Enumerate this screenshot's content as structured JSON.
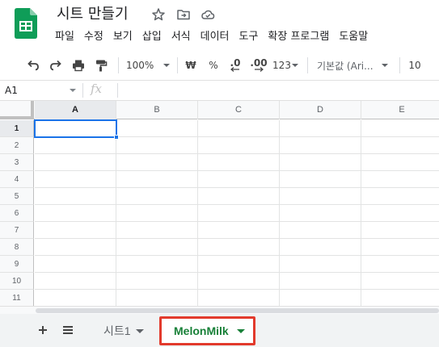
{
  "app": {
    "doc_title": "시트 만들기"
  },
  "menu": [
    "파일",
    "수정",
    "보기",
    "삽입",
    "서식",
    "데이터",
    "도구",
    "확장 프로그램",
    "도움말"
  ],
  "toolbar": {
    "zoom": "100%",
    "currency": "₩",
    "percent": "%",
    "dec_decrease": ".0",
    "dec_increase": ".00",
    "more_formats": "123",
    "font": "기본값 (Ari...",
    "font_size": "10"
  },
  "formula_bar": {
    "name_box": "A1",
    "fx": "fx",
    "value": ""
  },
  "grid": {
    "columns": [
      "A",
      "B",
      "C",
      "D",
      "E"
    ],
    "rows": [
      "1",
      "2",
      "3",
      "4",
      "5",
      "6",
      "7",
      "8",
      "9",
      "10",
      "11"
    ],
    "selected_cell": "A1"
  },
  "sheets": {
    "tabs": [
      {
        "label": "시트1",
        "active": false
      },
      {
        "label": "MelonMilk",
        "active": true
      }
    ]
  },
  "colors": {
    "logo_green": "#0f9d58",
    "active_tab_text": "#188038",
    "highlight_border": "#e23a2c",
    "selection_blue": "#1a73e8"
  }
}
